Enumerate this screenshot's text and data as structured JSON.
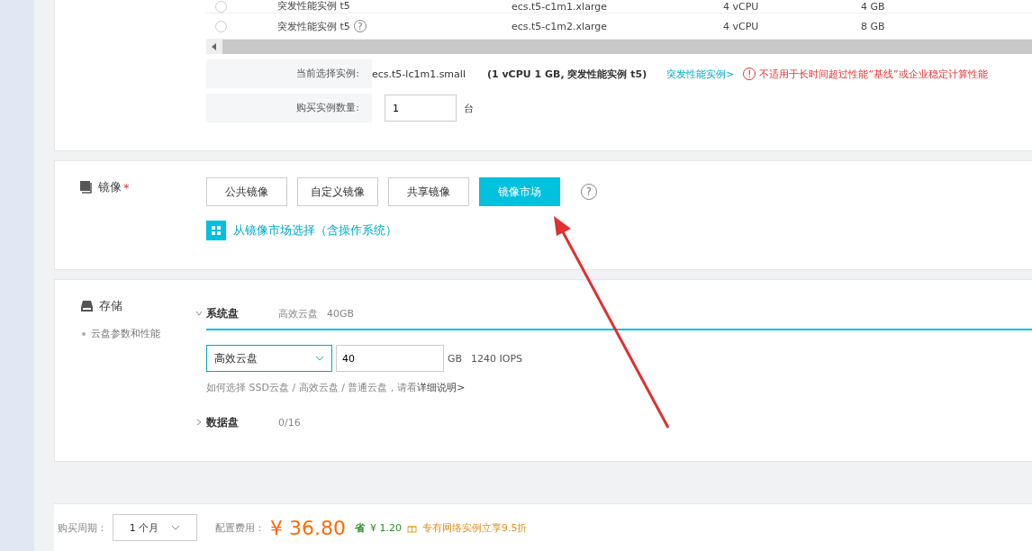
{
  "instance_table": {
    "rows": [
      {
        "name": "突发性能实例 t5",
        "help": "",
        "type": "ecs.t5-c1m1.xlarge",
        "vcpu": "4 vCPU",
        "memory": "4 GB",
        "selected": false
      },
      {
        "name": "突发性能实例 t5",
        "help": "?",
        "type": "ecs.t5-c1m2.xlarge",
        "vcpu": "4 vCPU",
        "memory": "8 GB",
        "selected": false
      }
    ]
  },
  "selection": {
    "label": "当前选择实例:",
    "instance": "ecs.t5-lc1m1.small",
    "spec": "(1 vCPU 1 GB, 突发性能实例 t5)",
    "link": "突发性能实例>",
    "warning_icon": "!",
    "warning": "不适用于长时间超过性能“基线”或企业稳定计算性能"
  },
  "quantity": {
    "label": "购买实例数量:",
    "value": "1",
    "unit": "台"
  },
  "image": {
    "title": "镜像",
    "required": "*",
    "tabs": [
      {
        "label": "公共镜像",
        "selected": false
      },
      {
        "label": "自定义镜像",
        "selected": false
      },
      {
        "label": "共享镜像",
        "selected": false
      },
      {
        "label": "镜像市场",
        "selected": true
      }
    ],
    "help": "?",
    "market_link": "从镜像市场选择（含操作系统）"
  },
  "storage": {
    "title": "存储",
    "note": "云盘参数和性能",
    "system_disk": {
      "label": "系统盘",
      "expanded": true,
      "summary_type": "高效云盘",
      "summary_size": "40GB",
      "type": "高效云盘",
      "size": "40",
      "unit": "GB",
      "iops": "1240 IOPS",
      "help_text": "如何选择 SSD云盘 / 高效云盘 / 普通云盘，请看",
      "help_link": "详细说明>"
    },
    "data_disk": {
      "label": "数据盘",
      "expanded": false,
      "count": "0/16"
    }
  },
  "footer": {
    "period_label": "购买周期：",
    "period": "1 个月",
    "cost_label": "配置费用：",
    "price": "¥ 36.80",
    "save_icon": "省",
    "saving": "¥ 1.20",
    "promo": "专有网络实例立享9.5折"
  }
}
